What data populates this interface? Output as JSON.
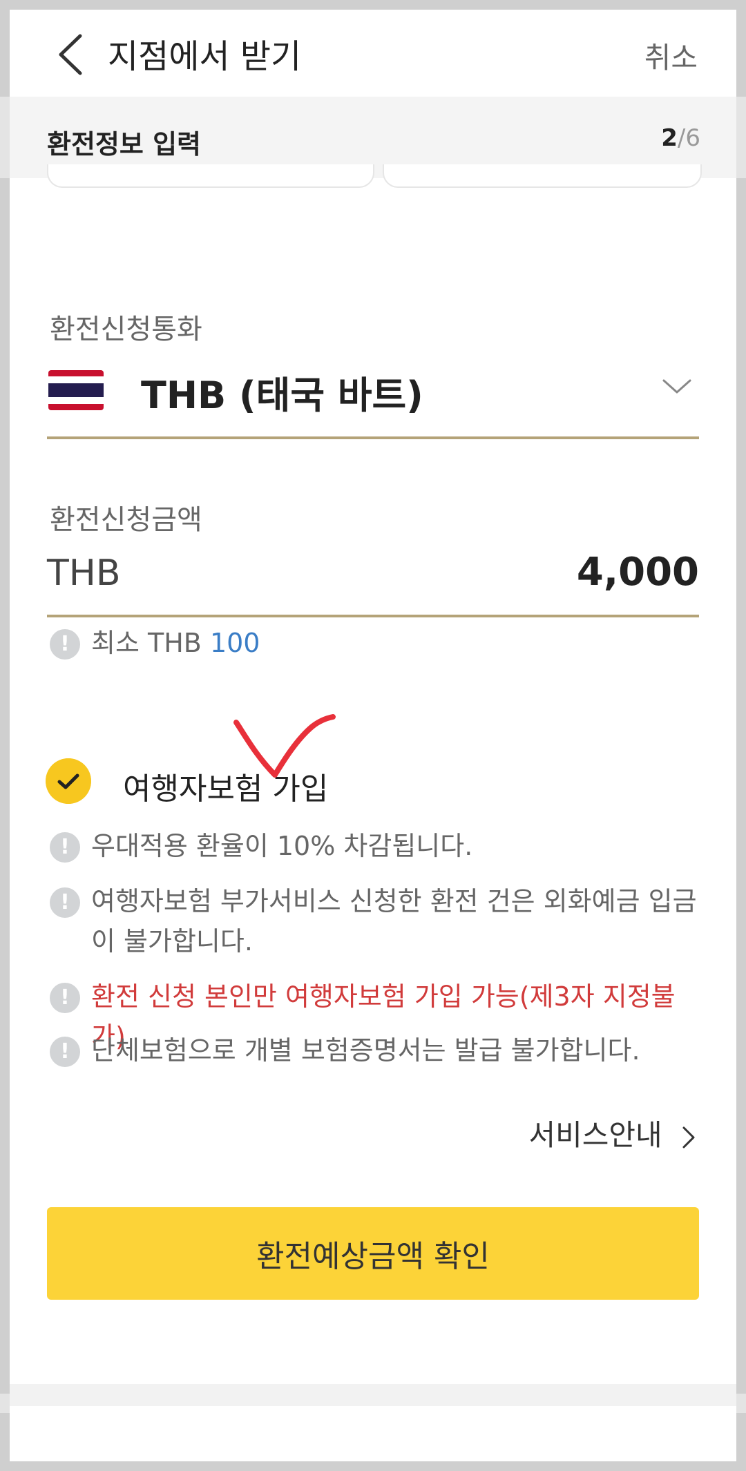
{
  "header": {
    "title": "지점에서 받기",
    "cancel_label": "취소",
    "back_icon": "chevron-left-icon"
  },
  "stepbar": {
    "title": "환전정보 입력",
    "current_step": "2",
    "separator": "/",
    "total_steps": "6"
  },
  "currency": {
    "label": "환전신청통화",
    "selected": "THB (태국 바트)",
    "flag_icon": "thailand-flag-icon"
  },
  "amount": {
    "label": "환전신청금액",
    "currency": "THB",
    "value": "4,000"
  },
  "minimum": {
    "prefix": "최소 THB",
    "value": "100"
  },
  "insurance": {
    "label": "여행자보험 가입",
    "checked": true,
    "notices": [
      "우대적용 환율이 10% 차감됩니다.",
      "여행자보험 부가서비스 신청한 환전 건은 외화예금 입금이 불가합니다.",
      "환전 신청 본인만 여행자보험 가입 가능(제3자 지정불가)",
      "단체보험으로 개별 보험증명서는 발급 불가합니다."
    ]
  },
  "service_link": "서비스안내",
  "confirm_button": "환전예상금액 확인",
  "colors": {
    "accent": "#fcd338",
    "check": "#f7c71f",
    "underline": "#b4a378",
    "warning": "#d13b3b",
    "link": "#3a7dc6"
  }
}
